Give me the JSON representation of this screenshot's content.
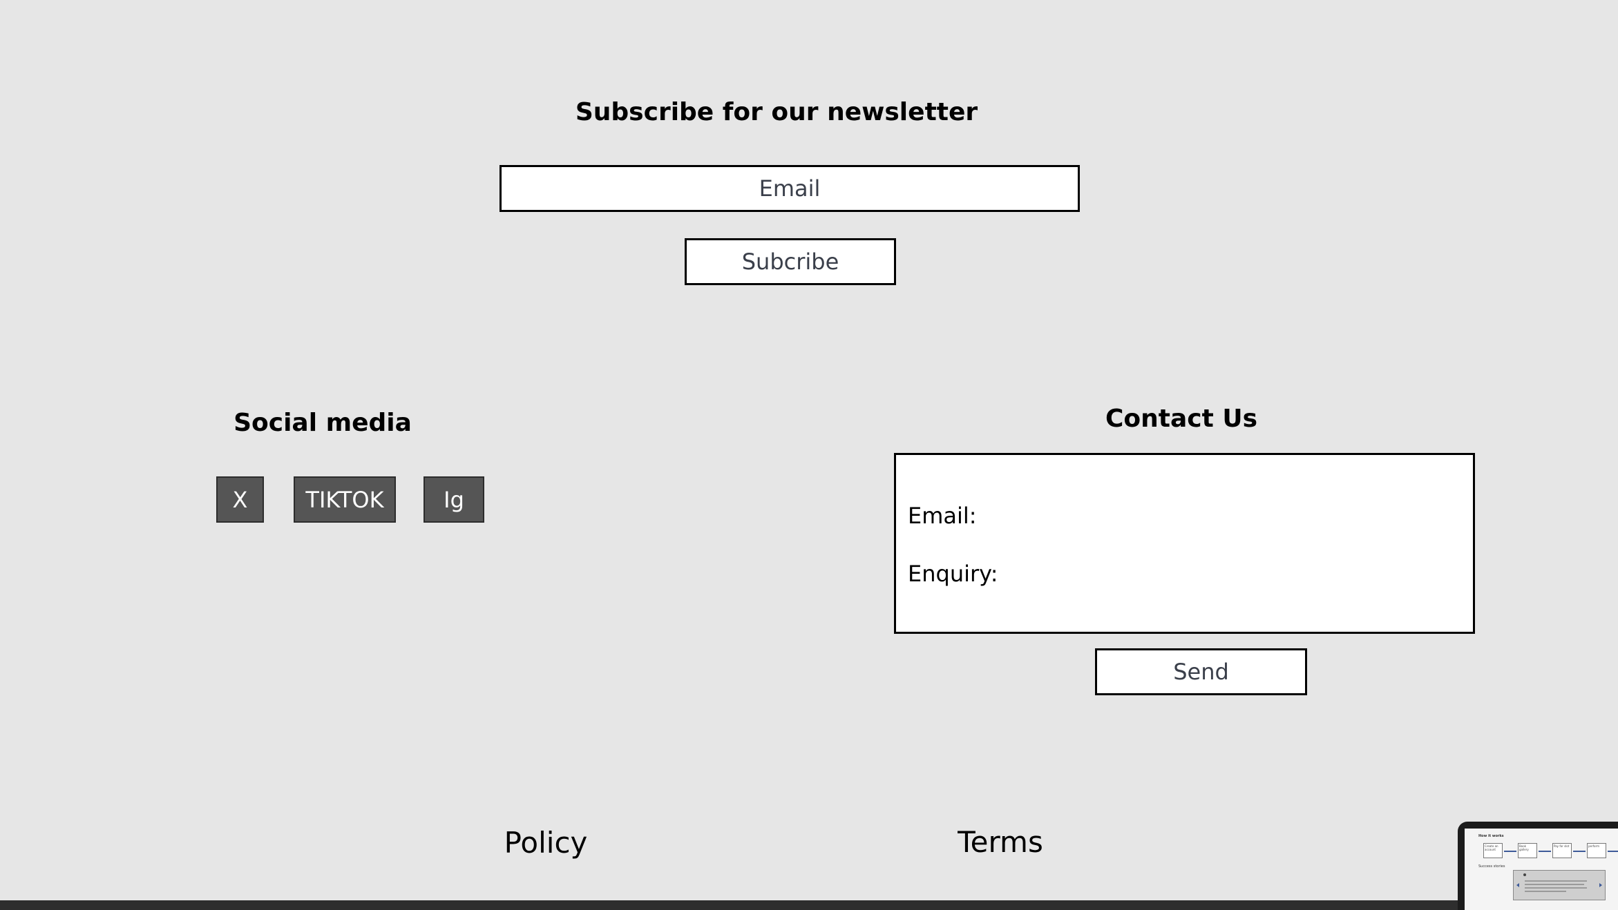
{
  "newsletter": {
    "heading": "Subscribe for our newsletter",
    "email_value": "Email",
    "subscribe_label": "Subcribe"
  },
  "social": {
    "heading": "Social media",
    "buttons": [
      "X",
      "TIKTOK",
      "Ig"
    ]
  },
  "contact": {
    "heading": "Contact Us",
    "email_label": "Email:",
    "enquiry_label": "Enquiry:",
    "send_label": "Send"
  },
  "footer": {
    "policy": "Policy",
    "terms": "Terms"
  },
  "thumbnail": {
    "title": "How it works",
    "steps": [
      "Create an account",
      "Book gallery",
      "Pay for slot",
      "perform"
    ],
    "section": "Success stories"
  },
  "colors": {
    "background": "#e6e6e6",
    "social_button": "#555555",
    "bottom_bar": "#2e2e2e"
  }
}
